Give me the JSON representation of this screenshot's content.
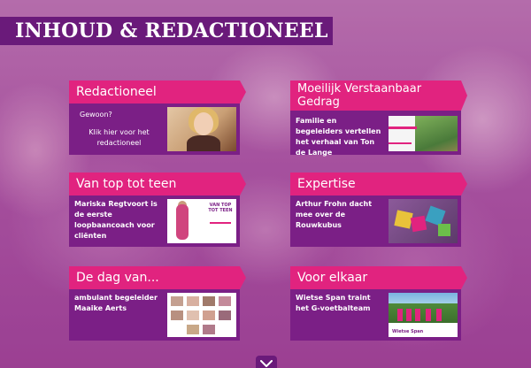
{
  "page": {
    "title": "INHOUD & REDACTIONEEL"
  },
  "cards": [
    {
      "title": "Redactioneel",
      "text_lines": [
        "Gewoon?",
        "Klik hier voor het redactioneel"
      ]
    },
    {
      "title": "Moeilijk Verstaanbaar Gedrag",
      "text": "Familie en begeleiders vertellen het verhaal van Ton de Lange"
    },
    {
      "title": "Van top tot teen",
      "text": "Mariska Regtvoort is de eerste loopbaancoach voor cliënten"
    },
    {
      "title": "Expertise",
      "text": "Arthur Frohn dacht mee over de Rouwkubus"
    },
    {
      "title": "De dag van...",
      "text": "ambulant begeleider Maaike Aerts"
    },
    {
      "title": "Voor elkaar",
      "text": "Wietse Span traint het G-voetbalteam"
    }
  ],
  "thumbs": {
    "mag_title": "VAN TOP TOT TEEN",
    "team_caption": "Wietse Span"
  },
  "colors": {
    "accent": "#e1237f",
    "dark_purple": "#7b1f86",
    "banner": "#6a1a7a"
  },
  "icons": {
    "scroll": "chevron-down-icon"
  }
}
